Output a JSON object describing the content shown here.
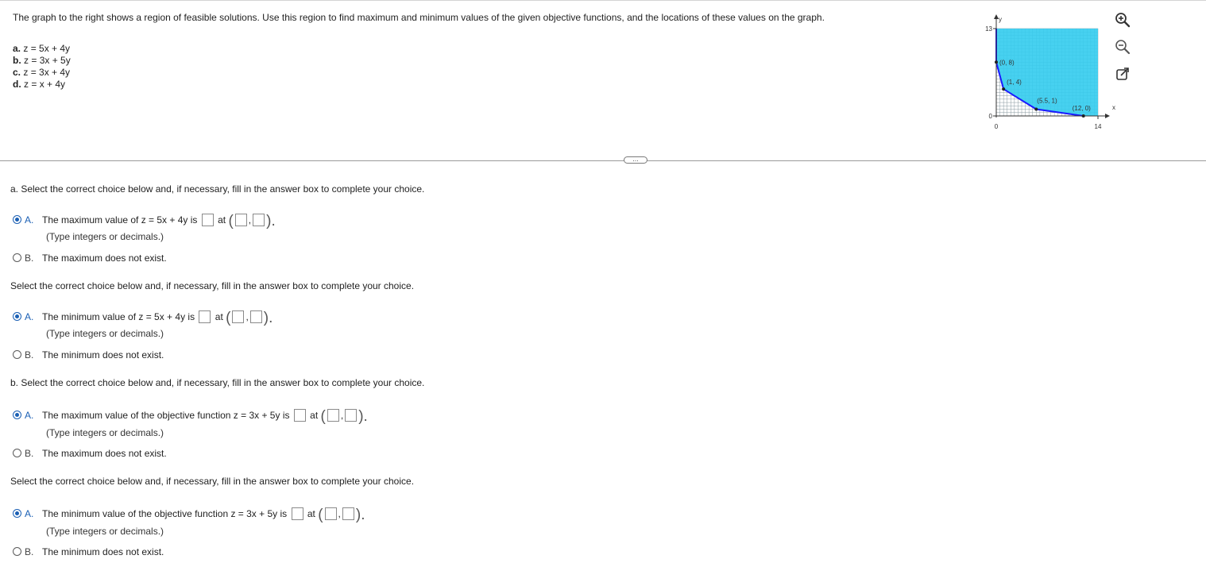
{
  "intro": "The graph to the right shows a region of feasible solutions. Use this region to find maximum and minimum values of the given objective functions, and the locations of these values on the graph.",
  "objectives": [
    {
      "label": "a.",
      "expr": "z = 5x + 4y"
    },
    {
      "label": "b.",
      "expr": "z = 3x + 5y"
    },
    {
      "label": "c.",
      "expr": "z = 3x + 4y"
    },
    {
      "label": "d.",
      "expr": "z = x + 4y"
    }
  ],
  "graph": {
    "y_axis_label": "y",
    "x_axis_label": "x",
    "y_max_tick": "13",
    "y_zero_tick": "0",
    "x_zero_tick": "0",
    "x_max_tick": "14",
    "x_range": [
      0,
      14
    ],
    "y_range": [
      0,
      13
    ],
    "region_color": "#33ccee",
    "boundary_color": "#1a1aff",
    "vertices": [
      {
        "label": "(0, 8)",
        "x": 0,
        "y": 8
      },
      {
        "label": "(1, 4)",
        "x": 1,
        "y": 4
      },
      {
        "label": "(5.5, 1)",
        "x": 5.5,
        "y": 1
      },
      {
        "label": "(12, 0)",
        "x": 12,
        "y": 0
      }
    ]
  },
  "tools": {
    "zoom_in": "zoom-in",
    "zoom_out": "zoom-out",
    "popout": "open-in-new-window"
  },
  "divider_handle": "...",
  "sections": {
    "a_max": {
      "prompt": "a. Select the correct choice below and, if necessary, fill in the answer box to complete your choice.",
      "choice_a_letter": "A.",
      "choice_a_text": "The maximum value of z = 5x + 4y is",
      "at": "at",
      "hint": "(Type integers or decimals.)",
      "choice_b_letter": "B.",
      "choice_b_text": "The maximum does not exist."
    },
    "a_min": {
      "prompt": "Select the correct choice below and, if necessary, fill in the answer box to complete your choice.",
      "choice_a_letter": "A.",
      "choice_a_text": "The minimum value of z = 5x + 4y is",
      "at": "at",
      "hint": "(Type integers or decimals.)",
      "choice_b_letter": "B.",
      "choice_b_text": "The minimum does not exist."
    },
    "b_max": {
      "prompt": "b. Select the correct choice below and, if necessary, fill in the answer box to complete your choice.",
      "choice_a_letter": "A.",
      "choice_a_text": "The maximum value of the objective function z = 3x + 5y is",
      "at": "at",
      "hint": "(Type integers or decimals.)",
      "choice_b_letter": "B.",
      "choice_b_text": "The maximum does not exist."
    },
    "b_min": {
      "prompt": "Select the correct choice below and, if necessary, fill in the answer box to complete your choice.",
      "choice_a_letter": "A.",
      "choice_a_text": "The minimum value of the objective function z = 3x + 5y is",
      "at": "at",
      "hint": "(Type integers or decimals.)",
      "choice_b_letter": "B.",
      "choice_b_text": "The minimum does not exist."
    }
  },
  "punct": {
    "open": "(",
    "comma": ",",
    "close": ")."
  }
}
